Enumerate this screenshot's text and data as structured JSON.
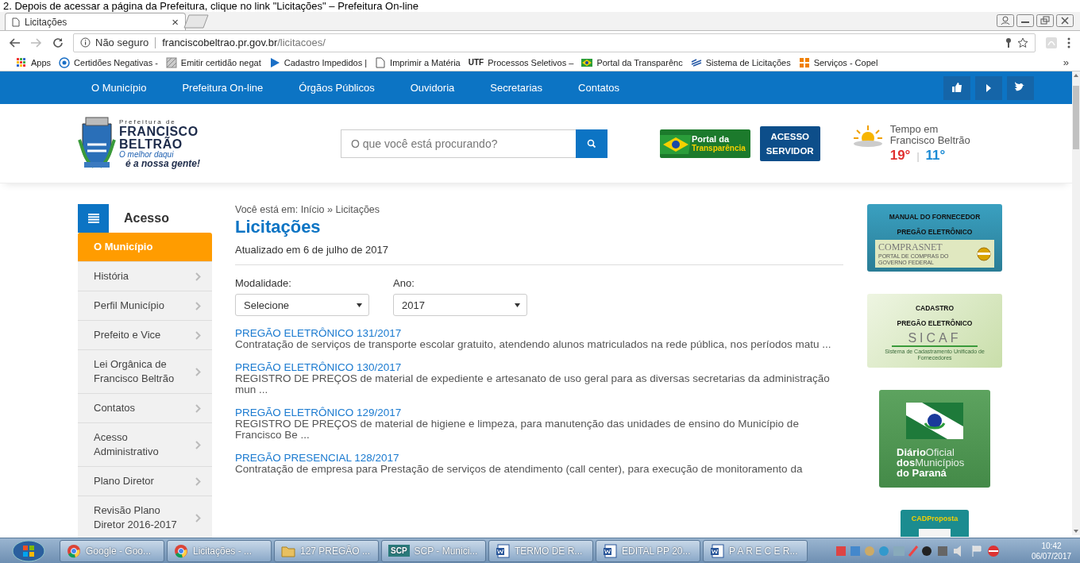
{
  "document_line": "2. Depois de acessar a página da Prefeitura, clique no link \"Licitações\" – Prefeitura On-line",
  "browser": {
    "tab": {
      "title": "Licitações",
      "close": "×"
    },
    "address": {
      "security": "Não seguro",
      "host": "franciscobeltrao.pr.gov.br",
      "path": "/licitacoes/"
    },
    "bookmarks": [
      {
        "label": "Apps",
        "kind": "apps"
      },
      {
        "label": "Certidões Negativas -",
        "kind": "globe"
      },
      {
        "label": "Emitir certidão negat",
        "kind": "image"
      },
      {
        "label": "Cadastro Impedidos |",
        "kind": "play"
      },
      {
        "label": "Imprimir a Matéria",
        "kind": "page"
      },
      {
        "label": "Processos Seletivos –",
        "kind": "utf",
        "badge": "UTF"
      },
      {
        "label": "Portal da Transparênc",
        "kind": "flag"
      },
      {
        "label": "Sistema de Licitações",
        "kind": "plane"
      },
      {
        "label": "Serviços - Copel",
        "kind": "copel"
      }
    ],
    "bookmarks_more": "»"
  },
  "site_nav": {
    "items": [
      "O Município",
      "Prefeitura On-line",
      "Órgãos Públicos",
      "Ouvidoria",
      "Secretarias",
      "Contatos"
    ],
    "social": [
      {
        "kind": "like"
      },
      {
        "kind": "play"
      },
      {
        "kind": "twitter"
      }
    ]
  },
  "header": {
    "logo": {
      "line1": "Prefeitura de",
      "line2": "FRANCISCO",
      "line3": "BELTRÃO",
      "slogan1": "O melhor daqui",
      "slogan2": "é a nossa gente!"
    },
    "search": {
      "placeholder": "O que você está procurando?"
    },
    "portal": {
      "line1": "Portal da",
      "line2": "Transparência"
    },
    "servidor": {
      "line1": "ACESSO",
      "line2": "SERVIDOR"
    },
    "weather": {
      "label": "Tempo em Francisco Beltrão",
      "max": "19°",
      "sep": "|",
      "min": "11°"
    }
  },
  "sidebar": {
    "title": "Acesso",
    "items": [
      {
        "label": "O Município",
        "selected": true
      },
      {
        "label": "História",
        "selected": false
      },
      {
        "label": "Perfil Município",
        "selected": false
      },
      {
        "label": "Prefeito e Vice",
        "selected": false
      },
      {
        "label": "Lei Orgânica de Francisco Beltrão",
        "selected": false
      },
      {
        "label": "Contatos",
        "selected": false
      },
      {
        "label": "Acesso Administrativo",
        "selected": false
      },
      {
        "label": "Plano Diretor",
        "selected": false
      },
      {
        "label": "Revisão Plano Diretor 2016-2017",
        "selected": false
      }
    ]
  },
  "main": {
    "breadcrumb": "Você está em: Início » Licitações",
    "title": "Licitações",
    "updated": "Atualizado em 6 de julho de 2017",
    "filters": [
      {
        "label": "Modalidade:",
        "value": "Selecione"
      },
      {
        "label": "Ano:",
        "value": "2017"
      }
    ],
    "items": [
      {
        "title": "PREGÃO ELETRÔNICO 131/2017",
        "description": "Contratação de serviços de transporte escolar gratuito, atendendo alunos matriculados na rede pública, nos períodos matu ..."
      },
      {
        "title": "PREGÃO ELETRÔNICO 130/2017",
        "description": "REGISTRO DE PREÇOS de material de expediente e artesanato de uso geral para as diversas secretarias da administração mun ..."
      },
      {
        "title": "PREGÃO ELETRÔNICO 129/2017",
        "description": "REGISTRO DE PREÇOS de material de higiene e limpeza, para manutenção das unidades de ensino do Município de Francisco Be ..."
      },
      {
        "title": "PREGÃO PRESENCIAL 128/2017",
        "description": "Contratação de empresa para Prestação de serviços de atendimento (call center), para execução de monitoramento da"
      }
    ]
  },
  "banners": [
    {
      "kind": "comprasnet",
      "line1": "MANUAL DO FORNECEDOR",
      "line2": "PREGÃO ELETRÔNICO",
      "logo": "COMPRASNET",
      "sub": "PORTAL DE COMPRAS DO GOVERNO FEDERAL"
    },
    {
      "kind": "sicaf",
      "line1": "CADASTRO",
      "line2": "PREGÃO ELETRÔNICO",
      "logo": "SICAF",
      "sub": "Sistema de Cadastramento Unificado de Fornecedores"
    },
    {
      "kind": "diario",
      "bold1": "Diário",
      "light1": "Oficial",
      "bold2": "dos",
      "light2": "Municípios",
      "line3": "do Paraná"
    },
    {
      "kind": "cad",
      "line1": "CADProposta"
    }
  ],
  "taskbar": {
    "items": [
      {
        "label": "Google - Goo...",
        "kind": "chrome"
      },
      {
        "label": "Licitações - ...",
        "kind": "chrome"
      },
      {
        "label": "127 PREGÃO ...",
        "kind": "folder"
      },
      {
        "label": "SCP - Munici...",
        "kind": "scp",
        "badge": "SCP"
      },
      {
        "label": "TERMO DE R...",
        "kind": "word"
      },
      {
        "label": "EDITAL PP 20...",
        "kind": "word"
      },
      {
        "label": "P A R E C E R...",
        "kind": "word"
      }
    ],
    "time": "10:42",
    "date": "06/07/2017"
  }
}
